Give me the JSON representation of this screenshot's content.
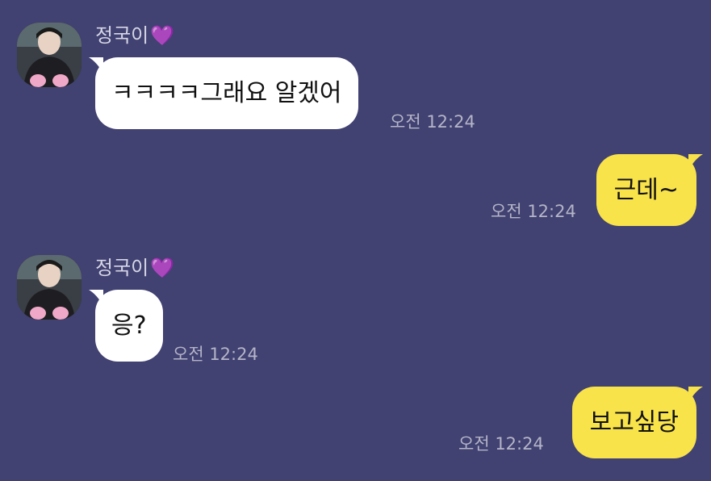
{
  "messages": [
    {
      "sender": "정국이",
      "sender_emoji": "💜",
      "text": "ㅋㅋㅋㅋ그래요 알겠어",
      "time": "오전 12:24"
    },
    {
      "text": "근데~",
      "time": "오전 12:24"
    },
    {
      "sender": "정국이",
      "sender_emoji": "💜",
      "text": "응?",
      "time": "오전 12:24"
    },
    {
      "text": "보고싶당",
      "time": "오전 12:24"
    }
  ],
  "colors": {
    "background": "#414172",
    "incoming_bubble": "#ffffff",
    "outgoing_bubble": "#f9e34a",
    "heart": "#8a3ff2",
    "timestamp": "#b4b4c8"
  }
}
